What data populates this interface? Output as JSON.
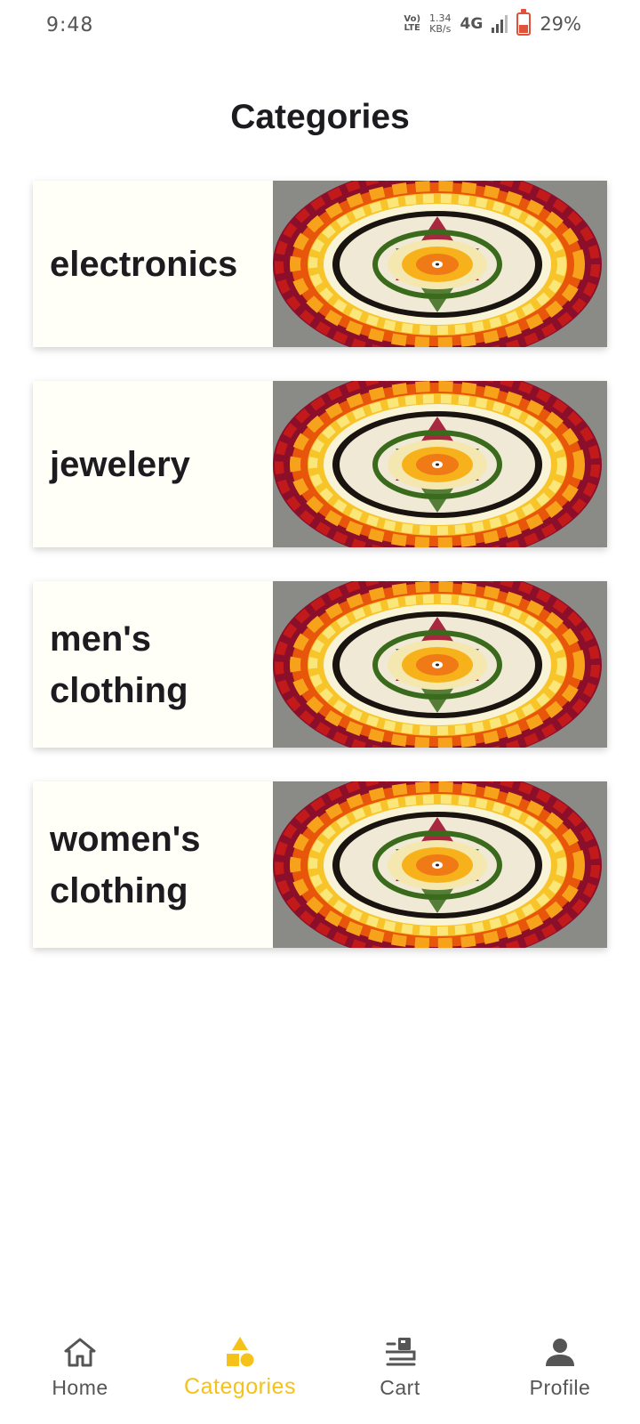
{
  "status": {
    "time": "9:48",
    "volte_top": "Vo)",
    "volte_bottom": "LTE",
    "speed_value": "1.34",
    "speed_unit": "KB/s",
    "network": "4G",
    "battery": "29%"
  },
  "header": {
    "title": "Categories"
  },
  "categories": [
    {
      "label": "electronics"
    },
    {
      "label": "jewelery"
    },
    {
      "label": "men's clothing"
    },
    {
      "label": "women's clothing"
    }
  ],
  "bottom_nav": {
    "items": [
      {
        "label": "Home",
        "icon": "home-icon"
      },
      {
        "label": "Categories",
        "icon": "categories-icon",
        "active": true
      },
      {
        "label": "Cart",
        "icon": "cart-icon"
      },
      {
        "label": "Profile",
        "icon": "profile-icon"
      }
    ]
  },
  "colors": {
    "accent": "#f5c21a",
    "card_bg": "#fffef7",
    "text": "#1c1b1f",
    "inactive": "#555555"
  }
}
